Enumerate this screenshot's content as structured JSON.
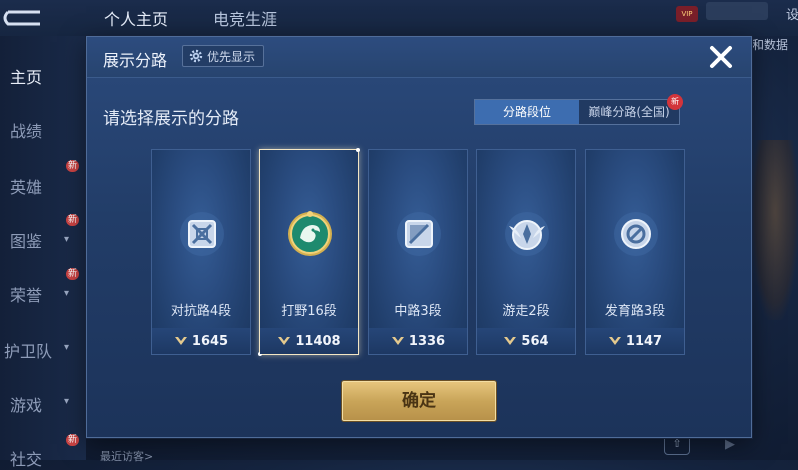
{
  "background": {
    "tabs": [
      "个人主页",
      "电竞生涯"
    ],
    "vip": "VIP",
    "settings_text": "设",
    "right_label": "和数据",
    "sidebar": [
      {
        "label": "主页",
        "active": true
      },
      {
        "label": "战绩"
      },
      {
        "label": "英雄",
        "new": "新"
      },
      {
        "label": "图鉴",
        "new": "新",
        "chevron": true
      },
      {
        "label": "荣誉",
        "new": "新",
        "chevron": true
      },
      {
        "label": "护卫队",
        "chevron": true
      },
      {
        "label": "游戏",
        "chevron": true
      },
      {
        "label": "社交",
        "new": "新"
      }
    ],
    "bottom_text": "最近访客>"
  },
  "dialog": {
    "title": "展示分路",
    "priority_label": "优先显示",
    "prompt": "请选择展示的分路",
    "toggle": {
      "options": [
        "分路段位",
        "巅峰分路(全国)"
      ],
      "selected": 0,
      "new_badge": "新"
    },
    "lanes": [
      {
        "label": "对抗路4段",
        "score": "1645",
        "icon": "clash-lane-icon",
        "selected": false
      },
      {
        "label": "打野16段",
        "score": "11408",
        "icon": "jungle-dragon-icon",
        "selected": true
      },
      {
        "label": "中路3段",
        "score": "1336",
        "icon": "mid-lane-icon",
        "selected": false
      },
      {
        "label": "游走2段",
        "score": "564",
        "icon": "roam-wings-icon",
        "selected": false
      },
      {
        "label": "发育路3段",
        "score": "1147",
        "icon": "farm-lane-icon",
        "selected": false
      }
    ],
    "confirm_label": "确定"
  },
  "colors": {
    "accent_blue": "#3d6db0",
    "gold": "#c9a559",
    "jungle_green": "#1e8a6e"
  }
}
